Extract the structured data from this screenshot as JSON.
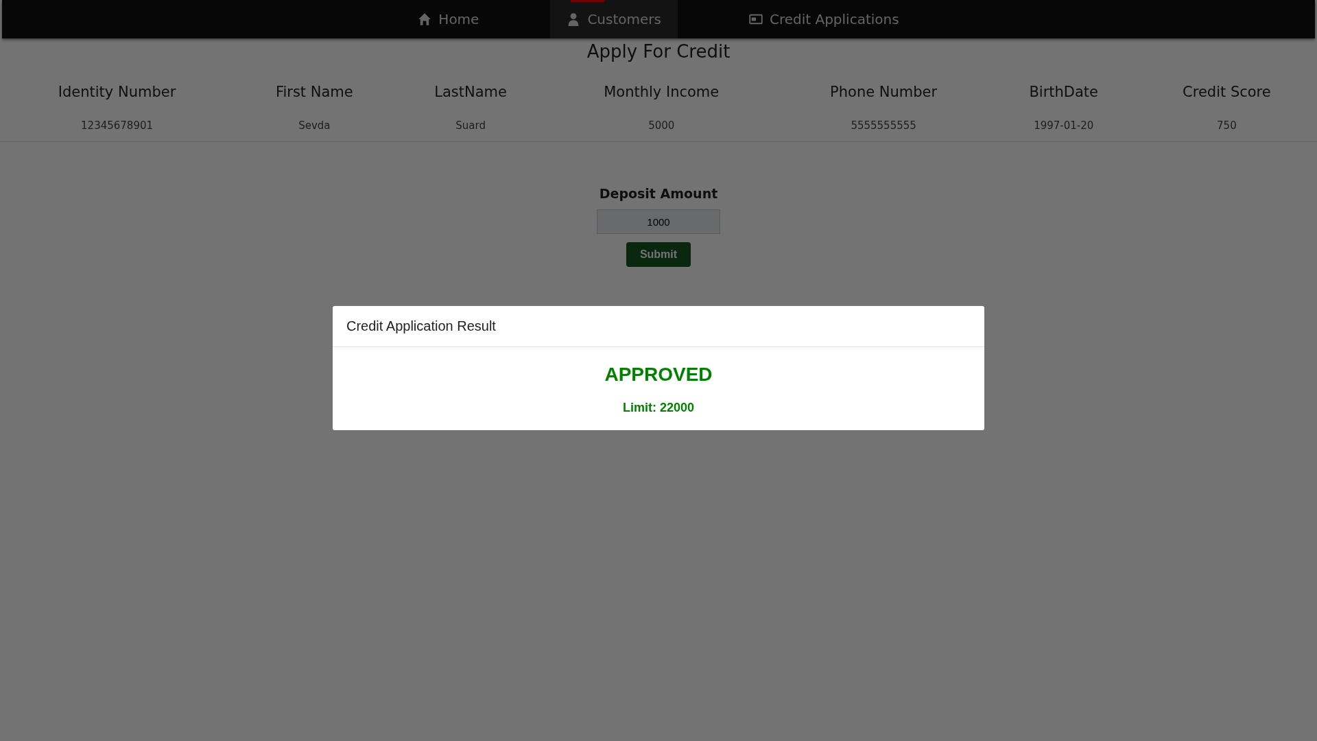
{
  "nav": {
    "items": [
      {
        "label": "Home",
        "kind": "home",
        "selected": false
      },
      {
        "label": "Customers",
        "kind": "user",
        "selected": true
      },
      {
        "label": "Credit Applications",
        "kind": "card",
        "selected": false
      }
    ]
  },
  "page": {
    "title": "Apply For Credit",
    "table": {
      "columns": [
        "Identity Number",
        "First Name",
        "LastName",
        "Monthly Income",
        "Phone Number",
        "BirthDate",
        "Credit Score"
      ],
      "rows": [
        [
          "12345678901",
          "Sevda",
          "Suard",
          "5000",
          "5555555555",
          "1997-01-20",
          "750"
        ]
      ]
    },
    "form": {
      "label": "Deposit Amount",
      "input": {
        "value": "1000"
      },
      "button": "Submit"
    }
  },
  "modal": {
    "title": "Credit Application Result",
    "status": "APPROVED",
    "approved": true,
    "limit": "Limit: 22000"
  }
}
